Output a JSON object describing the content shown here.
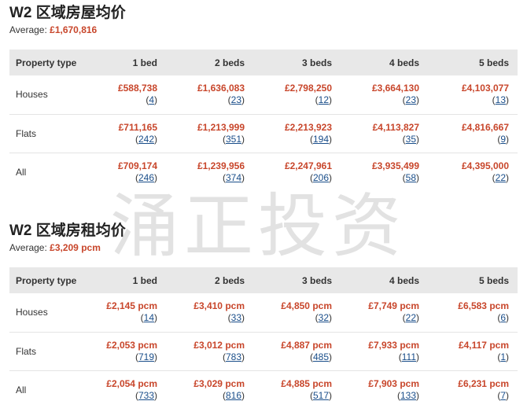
{
  "sale": {
    "title": "W2 区域房屋均价",
    "average_label": "Average:",
    "average_value": "£1,670,816",
    "headers": [
      "Property type",
      "1 bed",
      "2 beds",
      "3 beds",
      "4 beds",
      "5 beds"
    ],
    "rows": [
      {
        "type": "Houses",
        "cells": [
          {
            "price": "£588,738",
            "count": "4"
          },
          {
            "price": "£1,636,083",
            "count": "23"
          },
          {
            "price": "£2,798,250",
            "count": "12"
          },
          {
            "price": "£3,664,130",
            "count": "23"
          },
          {
            "price": "£4,103,077",
            "count": "13"
          }
        ]
      },
      {
        "type": "Flats",
        "cells": [
          {
            "price": "£711,165",
            "count": "242"
          },
          {
            "price": "£1,213,999",
            "count": "351"
          },
          {
            "price": "£2,213,923",
            "count": "194"
          },
          {
            "price": "£4,113,827",
            "count": "35"
          },
          {
            "price": "£4,816,667",
            "count": "9"
          }
        ]
      },
      {
        "type": "All",
        "cells": [
          {
            "price": "£709,174",
            "count": "246"
          },
          {
            "price": "£1,239,956",
            "count": "374"
          },
          {
            "price": "£2,247,961",
            "count": "206"
          },
          {
            "price": "£3,935,499",
            "count": "58"
          },
          {
            "price": "£4,395,000",
            "count": "22"
          }
        ]
      }
    ]
  },
  "rent": {
    "title": "W2 区域房租均价",
    "average_label": "Average:",
    "average_value": "£3,209 pcm",
    "headers": [
      "Property type",
      "1 bed",
      "2 beds",
      "3 beds",
      "4 beds",
      "5 beds"
    ],
    "rows": [
      {
        "type": "Houses",
        "cells": [
          {
            "price": "£2,145 pcm",
            "count": "14"
          },
          {
            "price": "£3,410 pcm",
            "count": "33"
          },
          {
            "price": "£4,850 pcm",
            "count": "32"
          },
          {
            "price": "£7,749 pcm",
            "count": "22"
          },
          {
            "price": "£6,583 pcm",
            "count": "6"
          }
        ]
      },
      {
        "type": "Flats",
        "cells": [
          {
            "price": "£2,053 pcm",
            "count": "719"
          },
          {
            "price": "£3,012 pcm",
            "count": "783"
          },
          {
            "price": "£4,887 pcm",
            "count": "485"
          },
          {
            "price": "£7,933 pcm",
            "count": "111"
          },
          {
            "price": "£4,117 pcm",
            "count": "1"
          }
        ]
      },
      {
        "type": "All",
        "cells": [
          {
            "price": "£2,054 pcm",
            "count": "733"
          },
          {
            "price": "£3,029 pcm",
            "count": "816"
          },
          {
            "price": "£4,885 pcm",
            "count": "517"
          },
          {
            "price": "£7,903 pcm",
            "count": "133"
          },
          {
            "price": "£6,231 pcm",
            "count": "7"
          }
        ]
      }
    ]
  },
  "watermark": "涌正投资",
  "colors": {
    "price": "#c8462b",
    "link": "#1a4e8a",
    "header_bg": "#e8e8e8"
  }
}
